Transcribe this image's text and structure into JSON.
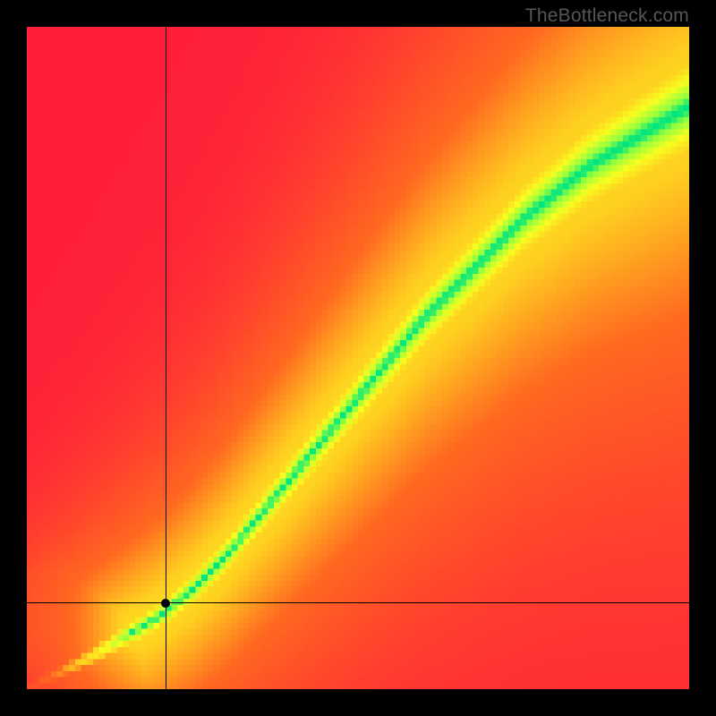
{
  "watermark": "TheBottleneck.com",
  "chart_data": {
    "type": "heatmap",
    "title": "",
    "xlabel": "",
    "ylabel": "",
    "xlim": [
      0,
      100
    ],
    "ylim": [
      0,
      100
    ],
    "crosshair": {
      "x": 21,
      "y": 13
    },
    "marker": {
      "x": 21,
      "y": 13
    },
    "curve": {
      "description": "Optimal-match ridge (green), value = 100 along this path",
      "points": [
        {
          "x": 0,
          "y": 0
        },
        {
          "x": 5,
          "y": 2.5
        },
        {
          "x": 10,
          "y": 5
        },
        {
          "x": 15,
          "y": 8
        },
        {
          "x": 20,
          "y": 11
        },
        {
          "x": 25,
          "y": 15
        },
        {
          "x": 30,
          "y": 20
        },
        {
          "x": 35,
          "y": 26
        },
        {
          "x": 40,
          "y": 32
        },
        {
          "x": 45,
          "y": 38
        },
        {
          "x": 50,
          "y": 44
        },
        {
          "x": 55,
          "y": 50
        },
        {
          "x": 60,
          "y": 56
        },
        {
          "x": 65,
          "y": 61
        },
        {
          "x": 70,
          "y": 66
        },
        {
          "x": 75,
          "y": 71
        },
        {
          "x": 80,
          "y": 75
        },
        {
          "x": 85,
          "y": 79
        },
        {
          "x": 90,
          "y": 82
        },
        {
          "x": 95,
          "y": 85
        },
        {
          "x": 100,
          "y": 88
        }
      ]
    },
    "colorscale": [
      {
        "value": 0,
        "color": "#ff1f3a"
      },
      {
        "value": 40,
        "color": "#ff6a20"
      },
      {
        "value": 60,
        "color": "#ffd020"
      },
      {
        "value": 80,
        "color": "#f8ff20"
      },
      {
        "value": 95,
        "color": "#8fff40"
      },
      {
        "value": 100,
        "color": "#00e580"
      }
    ],
    "grid_resolution": 110
  }
}
